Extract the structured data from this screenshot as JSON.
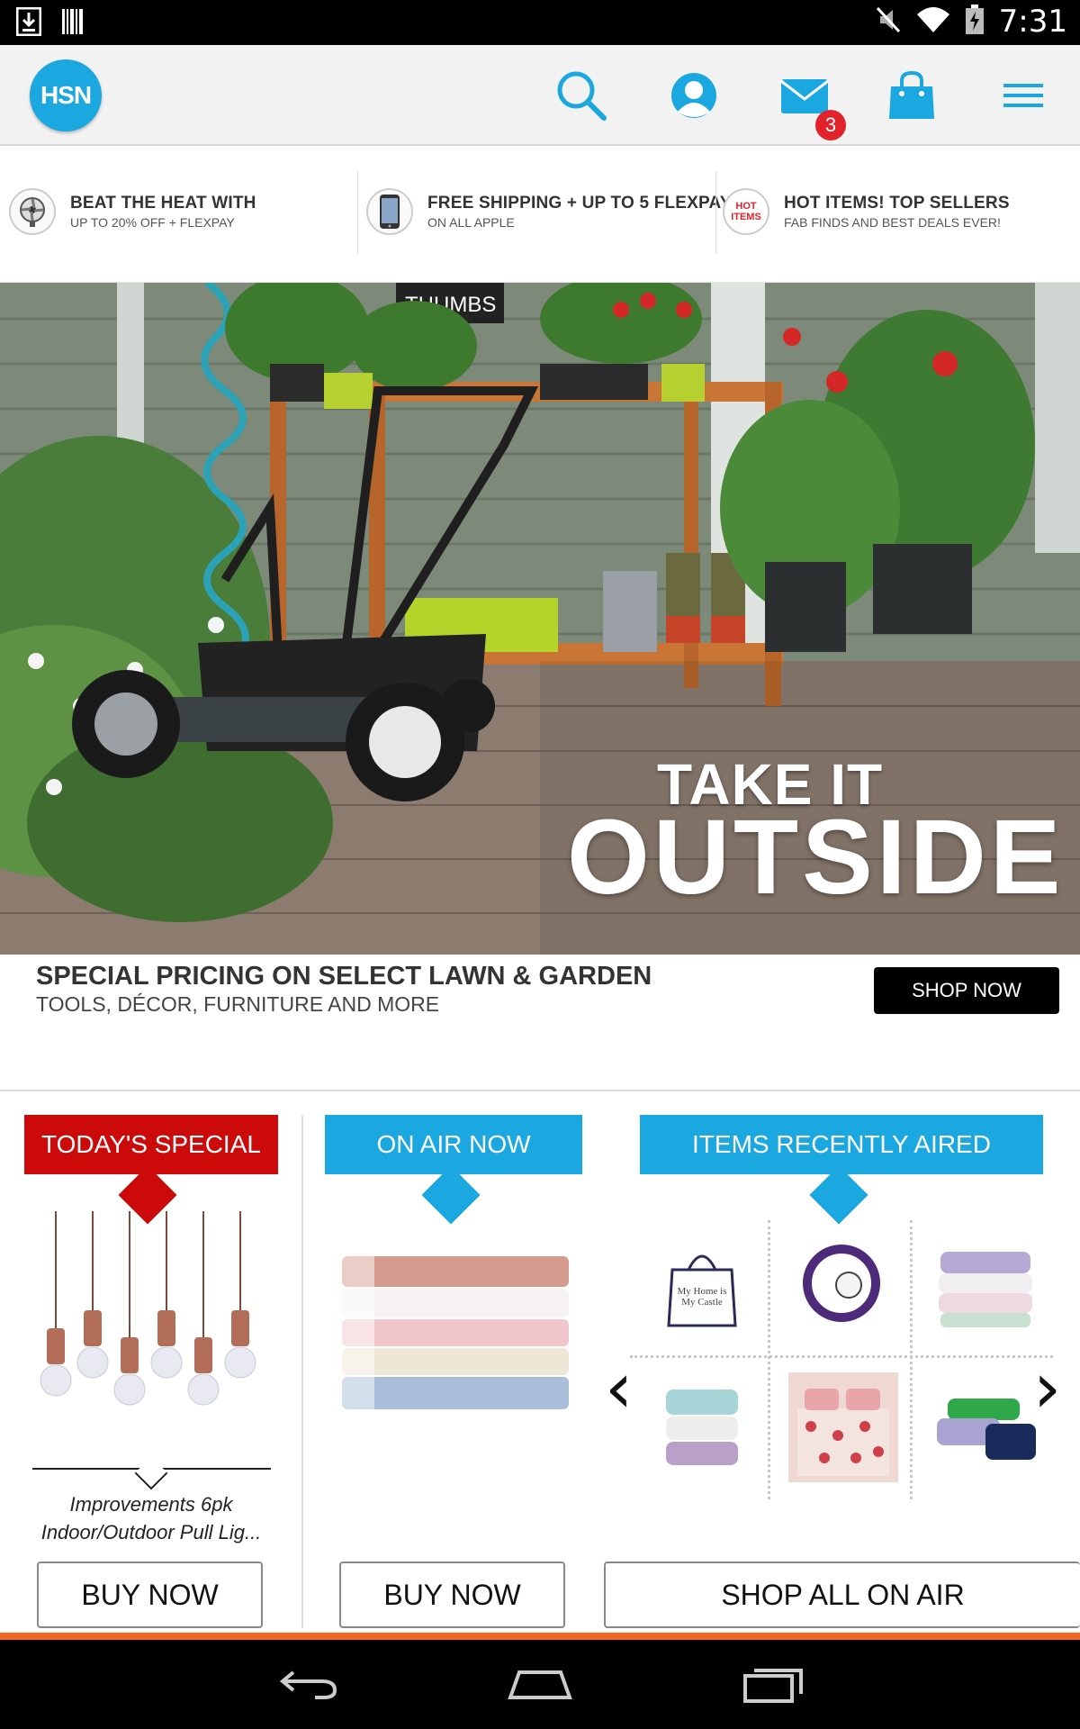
{
  "status_bar": {
    "time": "7:31"
  },
  "header": {
    "logo_text": "HSN",
    "mail_badge": "3"
  },
  "promos": [
    {
      "title": "BEAT THE HEAT WITH",
      "subtitle": "UP TO 20% OFF + FLEXPAY",
      "thumb": "fan"
    },
    {
      "title": "FREE SHIPPING + UP TO 5 FLEXPAY",
      "subtitle": "ON ALL APPLE",
      "thumb": "phone",
      "thumb_label": ""
    },
    {
      "title": "HOT ITEMS! TOP SELLERS",
      "subtitle": "FAB FINDS AND BEST DEALS EVER!",
      "thumb": "hot-items",
      "thumb_label": "HOT ITEMS"
    }
  ],
  "hero": {
    "headline_small": "TAKE IT",
    "headline_big": "OUTSIDE",
    "sign_text": "THUMBS",
    "caption_title": "SPECIAL PRICING ON SELECT LAWN & GARDEN",
    "caption_sub": "TOOLS, DÉCOR, FURNITURE AND MORE",
    "cta": "SHOP NOW"
  },
  "sections": {
    "todays_special": {
      "label": "TODAY'S SPECIAL",
      "product_name_line1": "Improvements 6pk",
      "product_name_line2": "Indoor/Outdoor Pull Lig...",
      "button": "BUY NOW",
      "color": "#cc0a0a"
    },
    "on_air_now": {
      "label": "ON AIR NOW",
      "button": "BUY NOW",
      "color": "#1ba7e0"
    },
    "recently_aired": {
      "label": "ITEMS RECENTLY AIRED",
      "button": "SHOP ALL ON AIR",
      "color": "#1ba7e0",
      "pillow_text": "My Home is My Castle"
    }
  },
  "colors": {
    "brand_blue": "#1ba7e0",
    "special_red": "#cc0a0a",
    "accent_orange": "#f26522"
  }
}
